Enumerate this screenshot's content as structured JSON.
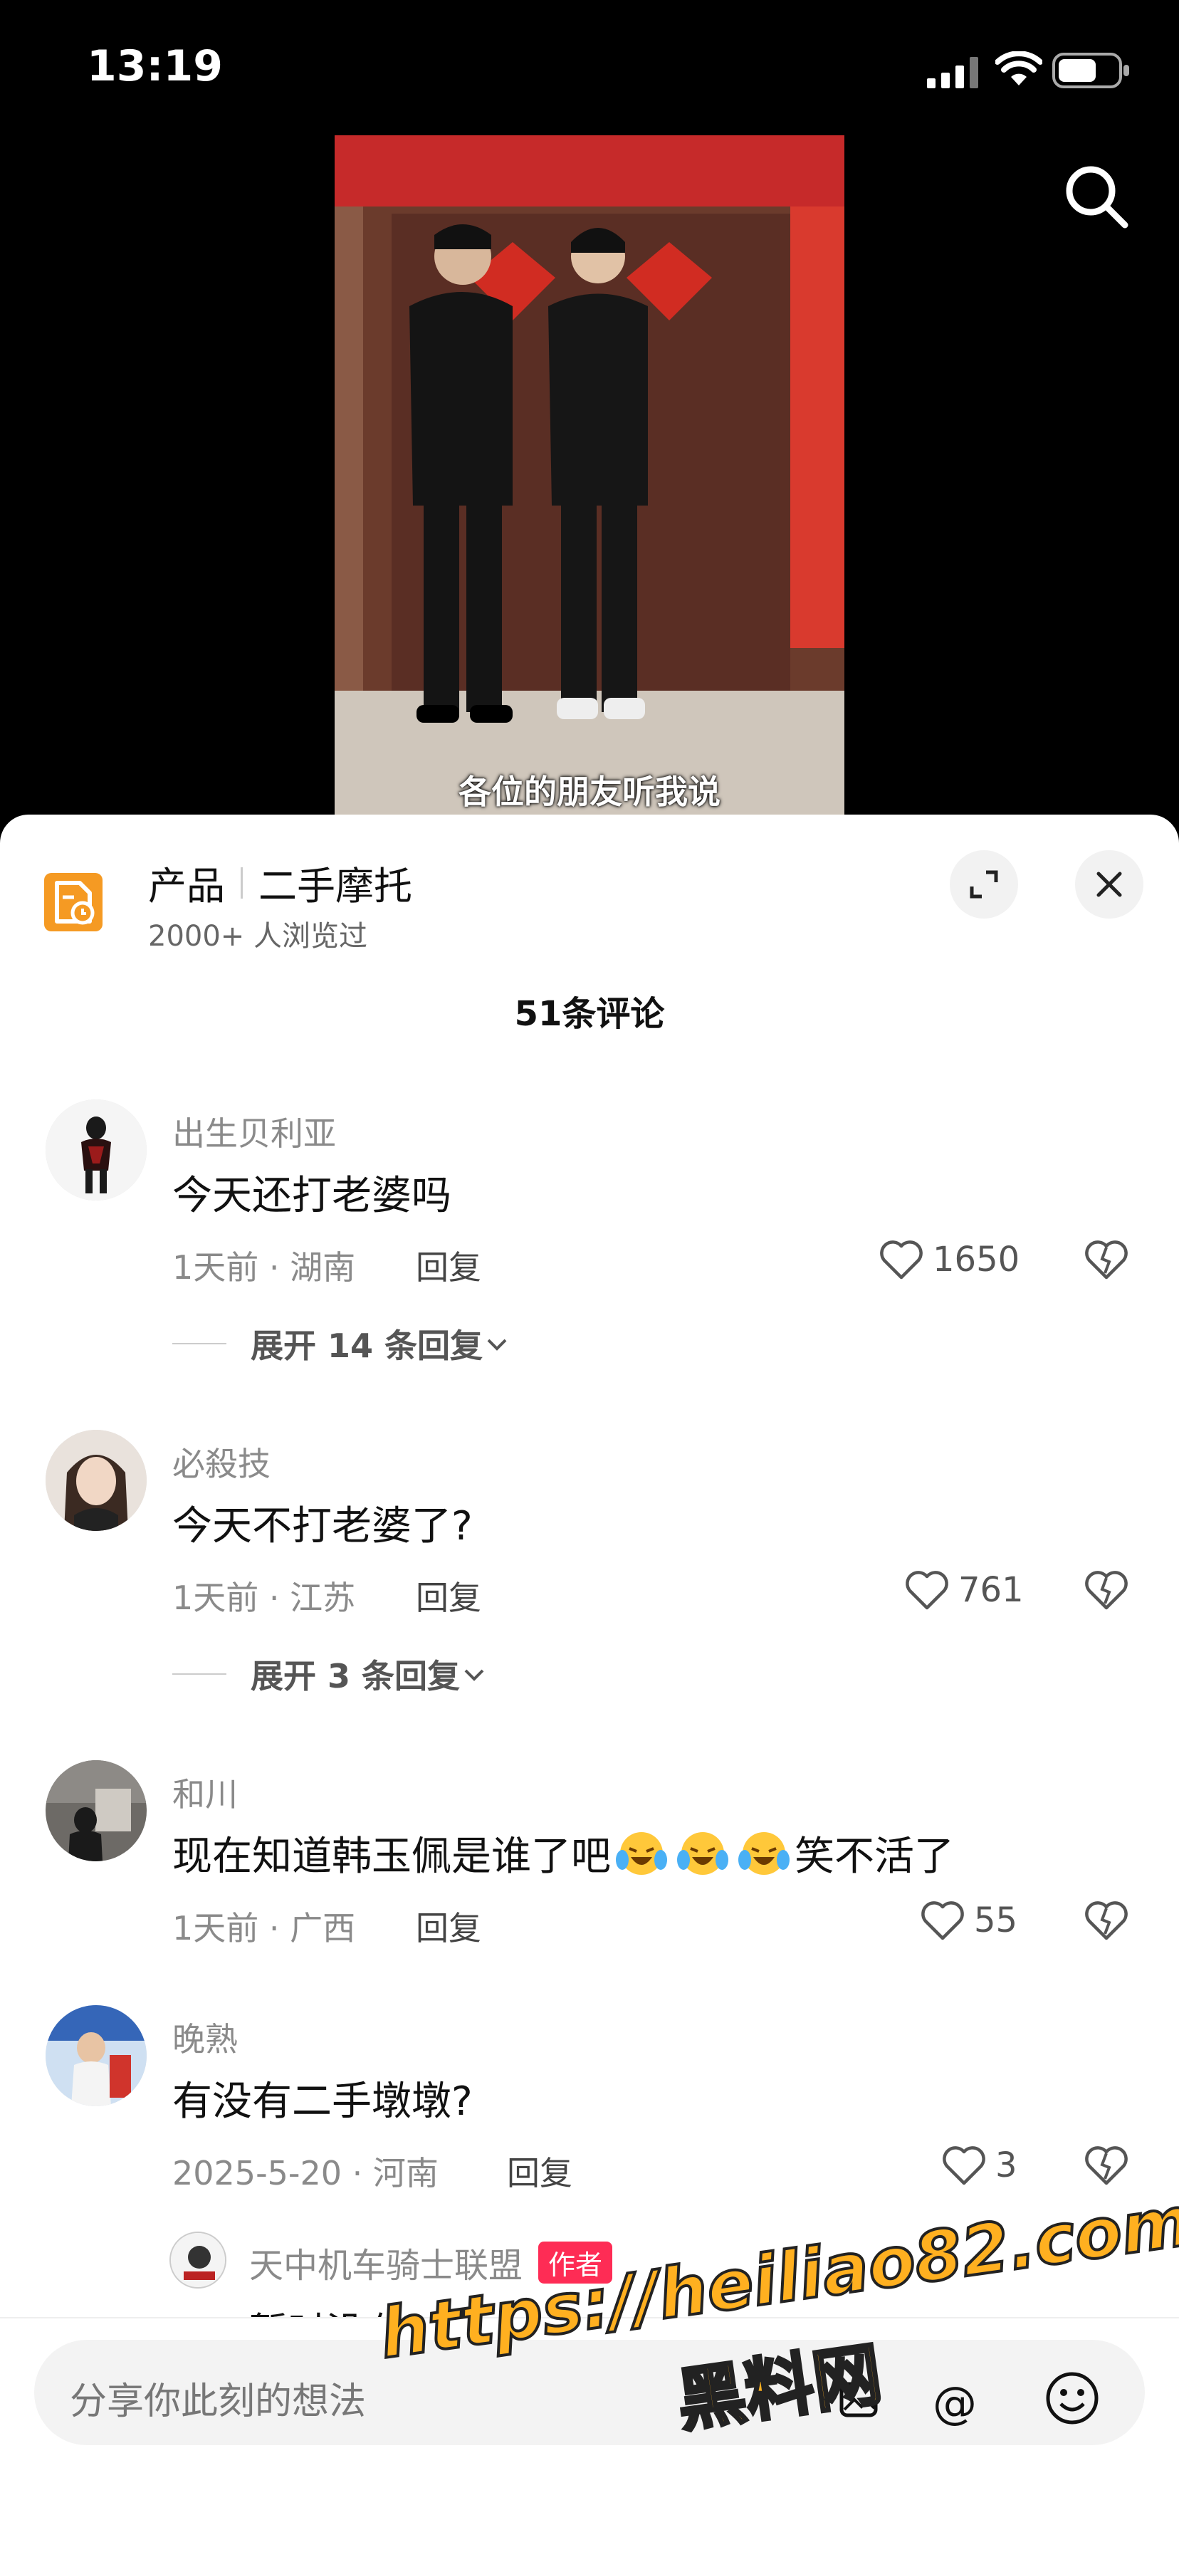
{
  "status_bar": {
    "time": "13:19"
  },
  "video": {
    "subtitle": "各位的朋友听我说"
  },
  "product": {
    "label": "产品",
    "name": "二手摩托",
    "views": "2000+ 人浏览过"
  },
  "comments_count": "51条评论",
  "comments": [
    {
      "user": "出生贝利亚",
      "text": "今天还打老婆吗",
      "meta": "1天前 · 湖南",
      "reply": "回复",
      "likes": "1650",
      "expand": "展开 14 条回复"
    },
    {
      "user": "必殺技",
      "text": "今天不打老婆了?",
      "meta": "1天前 · 江苏",
      "reply": "回复",
      "likes": "761",
      "expand": "展开 3 条回复"
    },
    {
      "user": "和川",
      "text_before": "现在知道韩玉佩是谁了吧",
      "text_after": "笑不活了",
      "meta": "1天前 · 广西",
      "reply": "回复",
      "likes": "55"
    },
    {
      "user": "晚熟",
      "text": "有没有二手墩墩?",
      "meta": "2025-5-20 · 河南",
      "reply": "回复",
      "likes": "3"
    }
  ],
  "sub_reply": {
    "user": "天中机车骑士联盟",
    "tag": "作者",
    "text": "暂时没有"
  },
  "input": {
    "placeholder": "分享你此刻的想法"
  },
  "watermark": {
    "line1": "https://heiliao82.com",
    "line2": "黑料网"
  },
  "colors": {
    "accent": "#fe2c55",
    "product_icon": "#f59a23"
  }
}
